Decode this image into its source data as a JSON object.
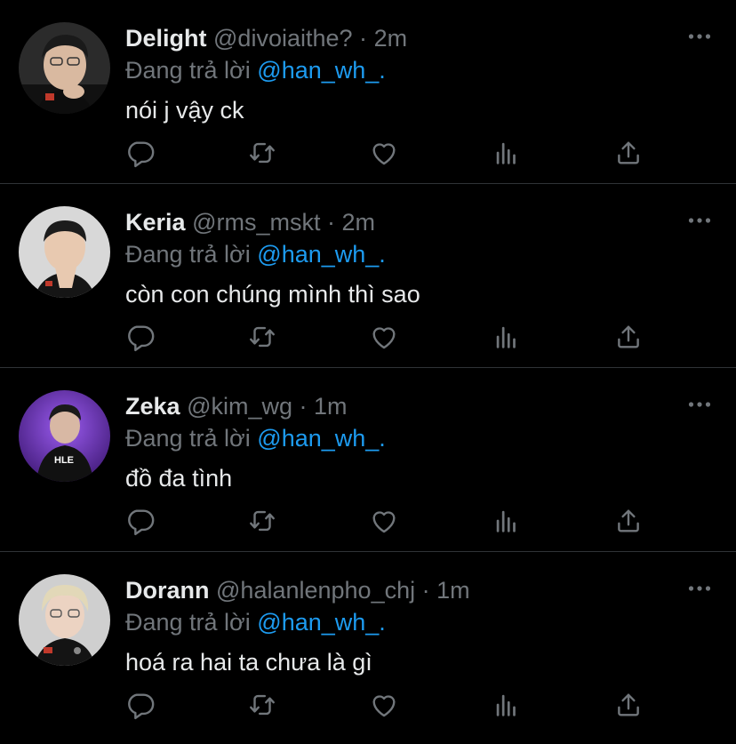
{
  "colors": {
    "background": "#000000",
    "primary_text": "#e7e9ea",
    "secondary_text": "#71767b",
    "mention": "#1d9bf0",
    "divider": "#2f3336"
  },
  "actions_icons": [
    "reply-icon",
    "retweet-icon",
    "like-icon",
    "analytics-icon",
    "share-icon"
  ],
  "tweets": [
    {
      "name": "Delight",
      "handle": "@divoiaithe?",
      "dot": "·",
      "time": "2m",
      "reply_prefix": "Đang trả lời",
      "reply_to": "@han_wh_.",
      "text": "nói j vậy ck"
    },
    {
      "name": "Keria",
      "handle": "@rms_mskt",
      "dot": "·",
      "time": "2m",
      "reply_prefix": "Đang trả lời",
      "reply_to": "@han_wh_.",
      "text": "còn con chúng mình thì sao"
    },
    {
      "name": "Zeka",
      "handle": "@kim_wg",
      "dot": "·",
      "time": "1m",
      "reply_prefix": "Đang trả lời",
      "reply_to": "@han_wh_.",
      "text": "đồ đa tình"
    },
    {
      "name": "Dorann",
      "handle": "@halanlenpho_chj",
      "dot": "·",
      "time": "1m",
      "reply_prefix": "Đang trả lời",
      "reply_to": "@han_wh_.",
      "text": "hoá ra hai ta chưa là gì"
    }
  ]
}
